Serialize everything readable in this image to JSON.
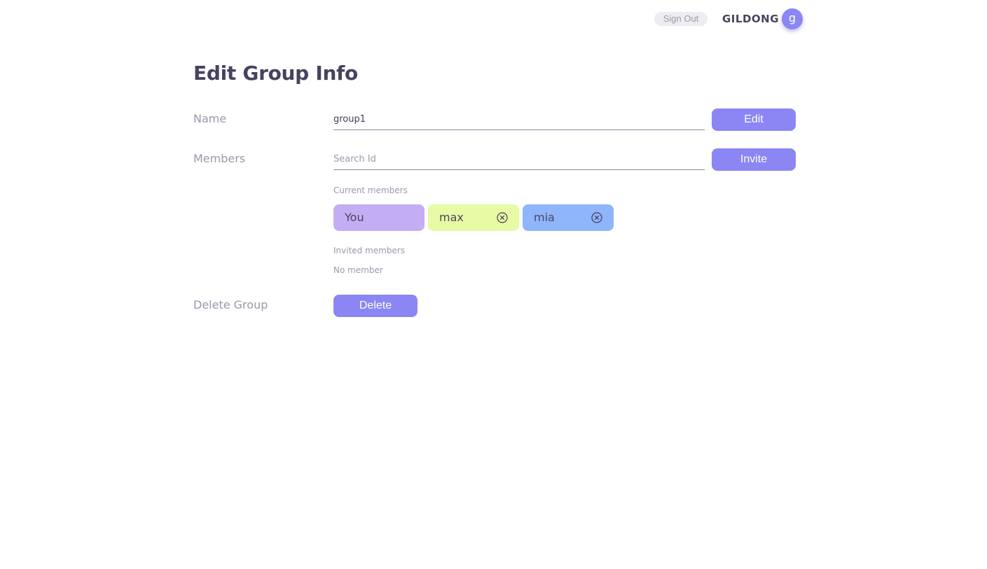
{
  "header": {
    "sign_out_label": "Sign Out",
    "username": "GILDONG",
    "avatar_letter": "g"
  },
  "page": {
    "title": "Edit Group Info"
  },
  "name_section": {
    "label": "Name",
    "value": "group1",
    "edit_label": "Edit"
  },
  "members_section": {
    "label": "Members",
    "search_placeholder": "Search Id",
    "invite_label": "Invite",
    "current_label": "Current members",
    "current_members": [
      {
        "name": "You",
        "color": "#c4aef3",
        "removable": false
      },
      {
        "name": "max",
        "color": "#e6fba3",
        "removable": true
      },
      {
        "name": "mia",
        "color": "#8fb5fb",
        "removable": true
      }
    ],
    "invited_label": "Invited members",
    "invited_empty": "No member"
  },
  "delete_section": {
    "label": "Delete Group",
    "delete_label": "Delete"
  },
  "colors": {
    "accent": "#8b86f4"
  }
}
